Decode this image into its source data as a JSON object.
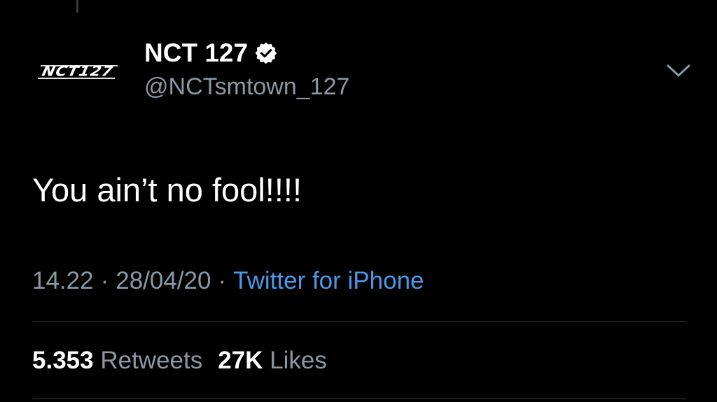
{
  "tweet": {
    "author": {
      "display_name": "NCT 127",
      "handle": "@NCTsmtown_127",
      "avatar_text": "NCT127",
      "verified": true
    },
    "text": "You ain’t no fool!!!!",
    "meta": {
      "time": "14.22",
      "date": "28/04/20",
      "separator": "·",
      "source": "Twitter for iPhone"
    },
    "stats": {
      "retweets_count": "5.353",
      "retweets_label": "Retweets",
      "likes_count": "27K",
      "likes_label": "Likes"
    },
    "icons": {
      "verified": "verified-badge-icon",
      "menu": "chevron-down-icon"
    }
  },
  "colors": {
    "background": "#000000",
    "text_primary": "#ffffff",
    "text_secondary": "#8b98a5",
    "link": "#4a99e9",
    "divider": "#2f3336"
  }
}
